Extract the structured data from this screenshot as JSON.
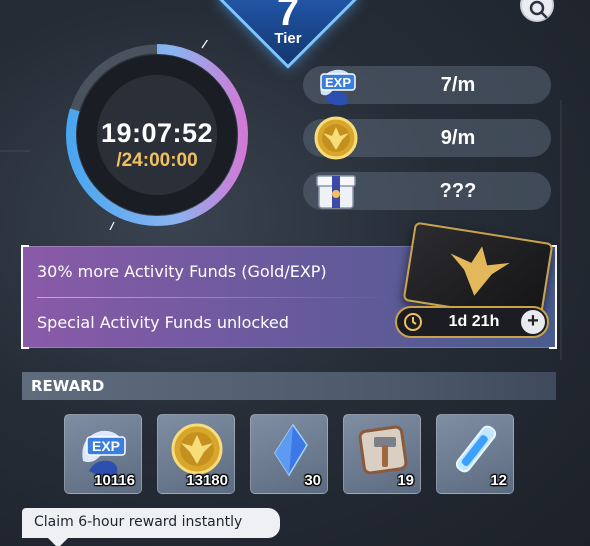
{
  "tier": {
    "number": "7",
    "label": "Tier"
  },
  "timer": {
    "elapsed": "19:07:52",
    "total": "/24:00:00",
    "progress": 0.797
  },
  "rates": [
    {
      "icon": "exp-icon",
      "value": "7/m"
    },
    {
      "icon": "gold-coin-icon",
      "value": "9/m"
    },
    {
      "icon": "gift-box-icon",
      "value": "???"
    }
  ],
  "promo": {
    "line1": "30% more Activity Funds (Gold/EXP)",
    "line2": "Special Activity Funds unlocked",
    "time_left": "1d 21h",
    "plus": "+"
  },
  "reward": {
    "header": "REWARD",
    "items": [
      {
        "icon": "exp-icon",
        "qty": "10116",
        "badge": "EXP"
      },
      {
        "icon": "gold-coin-icon",
        "qty": "13180"
      },
      {
        "icon": "blue-crystal-icon",
        "qty": "30"
      },
      {
        "icon": "hammer-icon",
        "qty": "19"
      },
      {
        "icon": "vial-icon",
        "qty": "12"
      }
    ]
  },
  "claim_tooltip": "Claim 6-hour reward instantly",
  "colors": {
    "ring_blue": "#4aa6f0",
    "ring_pink": "#d07ad6",
    "gold": "#f2c060",
    "promo_from": "#8a5aa8",
    "promo_to": "#4a5c8e"
  }
}
